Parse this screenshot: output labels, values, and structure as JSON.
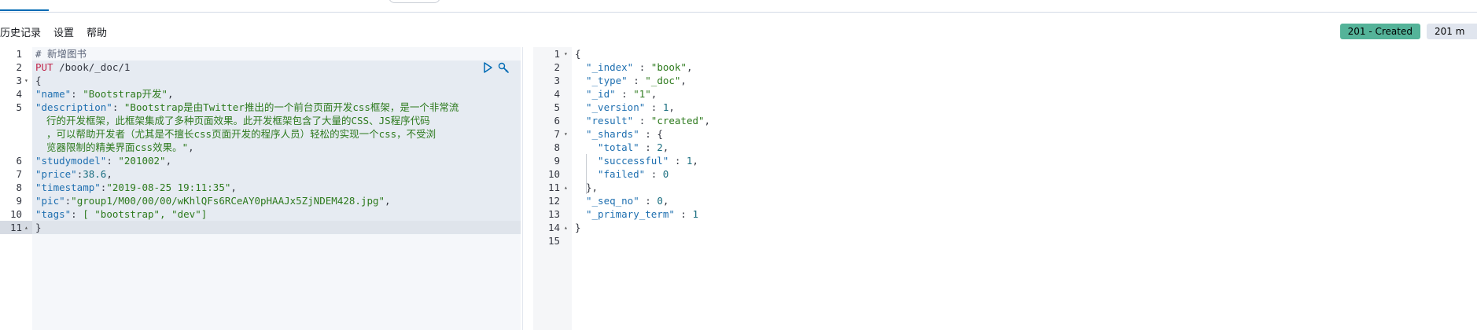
{
  "menu": {
    "history": "历史记录",
    "settings": "设置",
    "help": "帮助"
  },
  "status": {
    "code_label": "201 - Created",
    "time_label": "201 m"
  },
  "colors": {
    "status_bg": "#54b399",
    "accent": "#006bb4",
    "method": "#c0264b",
    "string": "#2d7a1d",
    "key": "#1e6fb0"
  },
  "request": {
    "comment": "# 新增图书",
    "method": "PUT",
    "path": "/book/_doc/1",
    "open": "{",
    "name_key": "\"name\"",
    "name_val": "\"Bootstrap开发\"",
    "desc_key": "\"description\"",
    "desc_val_1": "\"Bootstrap是由Twitter推出的一个前台页面开发css框架，是一个非常流",
    "desc_val_2": "行的开发框架，此框架集成了多种页面效果。此开发框架包含了大量的CSS、JS程序代码",
    "desc_val_3": "，可以帮助开发者（尤其是不擅长css页面开发的程序人员）轻松的实现一个css，不受浏",
    "desc_val_4": "览器限制的精美界面css效果。\"",
    "studymodel_key": "\"studymodel\"",
    "studymodel_val": "\"201002\"",
    "price_key": "\"price\"",
    "price_val": "38.6",
    "timestamp_key": "\"timestamp\"",
    "timestamp_val": "\"2019-08-25 19:11:35\"",
    "pic_key": "\"pic\"",
    "pic_val": "\"group1/M00/00/00/wKhlQFs6RCeAY0pHAAJx5ZjNDEM428.jpg\"",
    "tags_key": "\"tags\"",
    "tags_val": "[ \"bootstrap\", \"dev\"]",
    "close": "}"
  },
  "request_line_numbers": [
    "1",
    "2",
    "3",
    "4",
    "5",
    "6",
    "7",
    "8",
    "9",
    "10",
    "11"
  ],
  "response": {
    "l1": "{",
    "index_key": "\"_index\"",
    "index_val": "\"book\"",
    "type_key": "\"_type\"",
    "type_val": "\"_doc\"",
    "id_key": "\"_id\"",
    "id_val": "\"1\"",
    "version_key": "\"_version\"",
    "version_val": "1",
    "result_key": "\"result\"",
    "result_val": "\"created\"",
    "shards_key": "\"_shards\"",
    "shards_open": "{",
    "total_key": "\"total\"",
    "total_val": "2",
    "successful_key": "\"successful\"",
    "successful_val": "1",
    "failed_key": "\"failed\"",
    "failed_val": "0",
    "shards_close": "},",
    "seq_key": "\"_seq_no\"",
    "seq_val": "0",
    "term_key": "\"_primary_term\"",
    "term_val": "1",
    "l14": "}"
  },
  "response_line_numbers": [
    "1",
    "2",
    "3",
    "4",
    "5",
    "6",
    "7",
    "8",
    "9",
    "10",
    "11",
    "12",
    "13",
    "14",
    "15"
  ]
}
